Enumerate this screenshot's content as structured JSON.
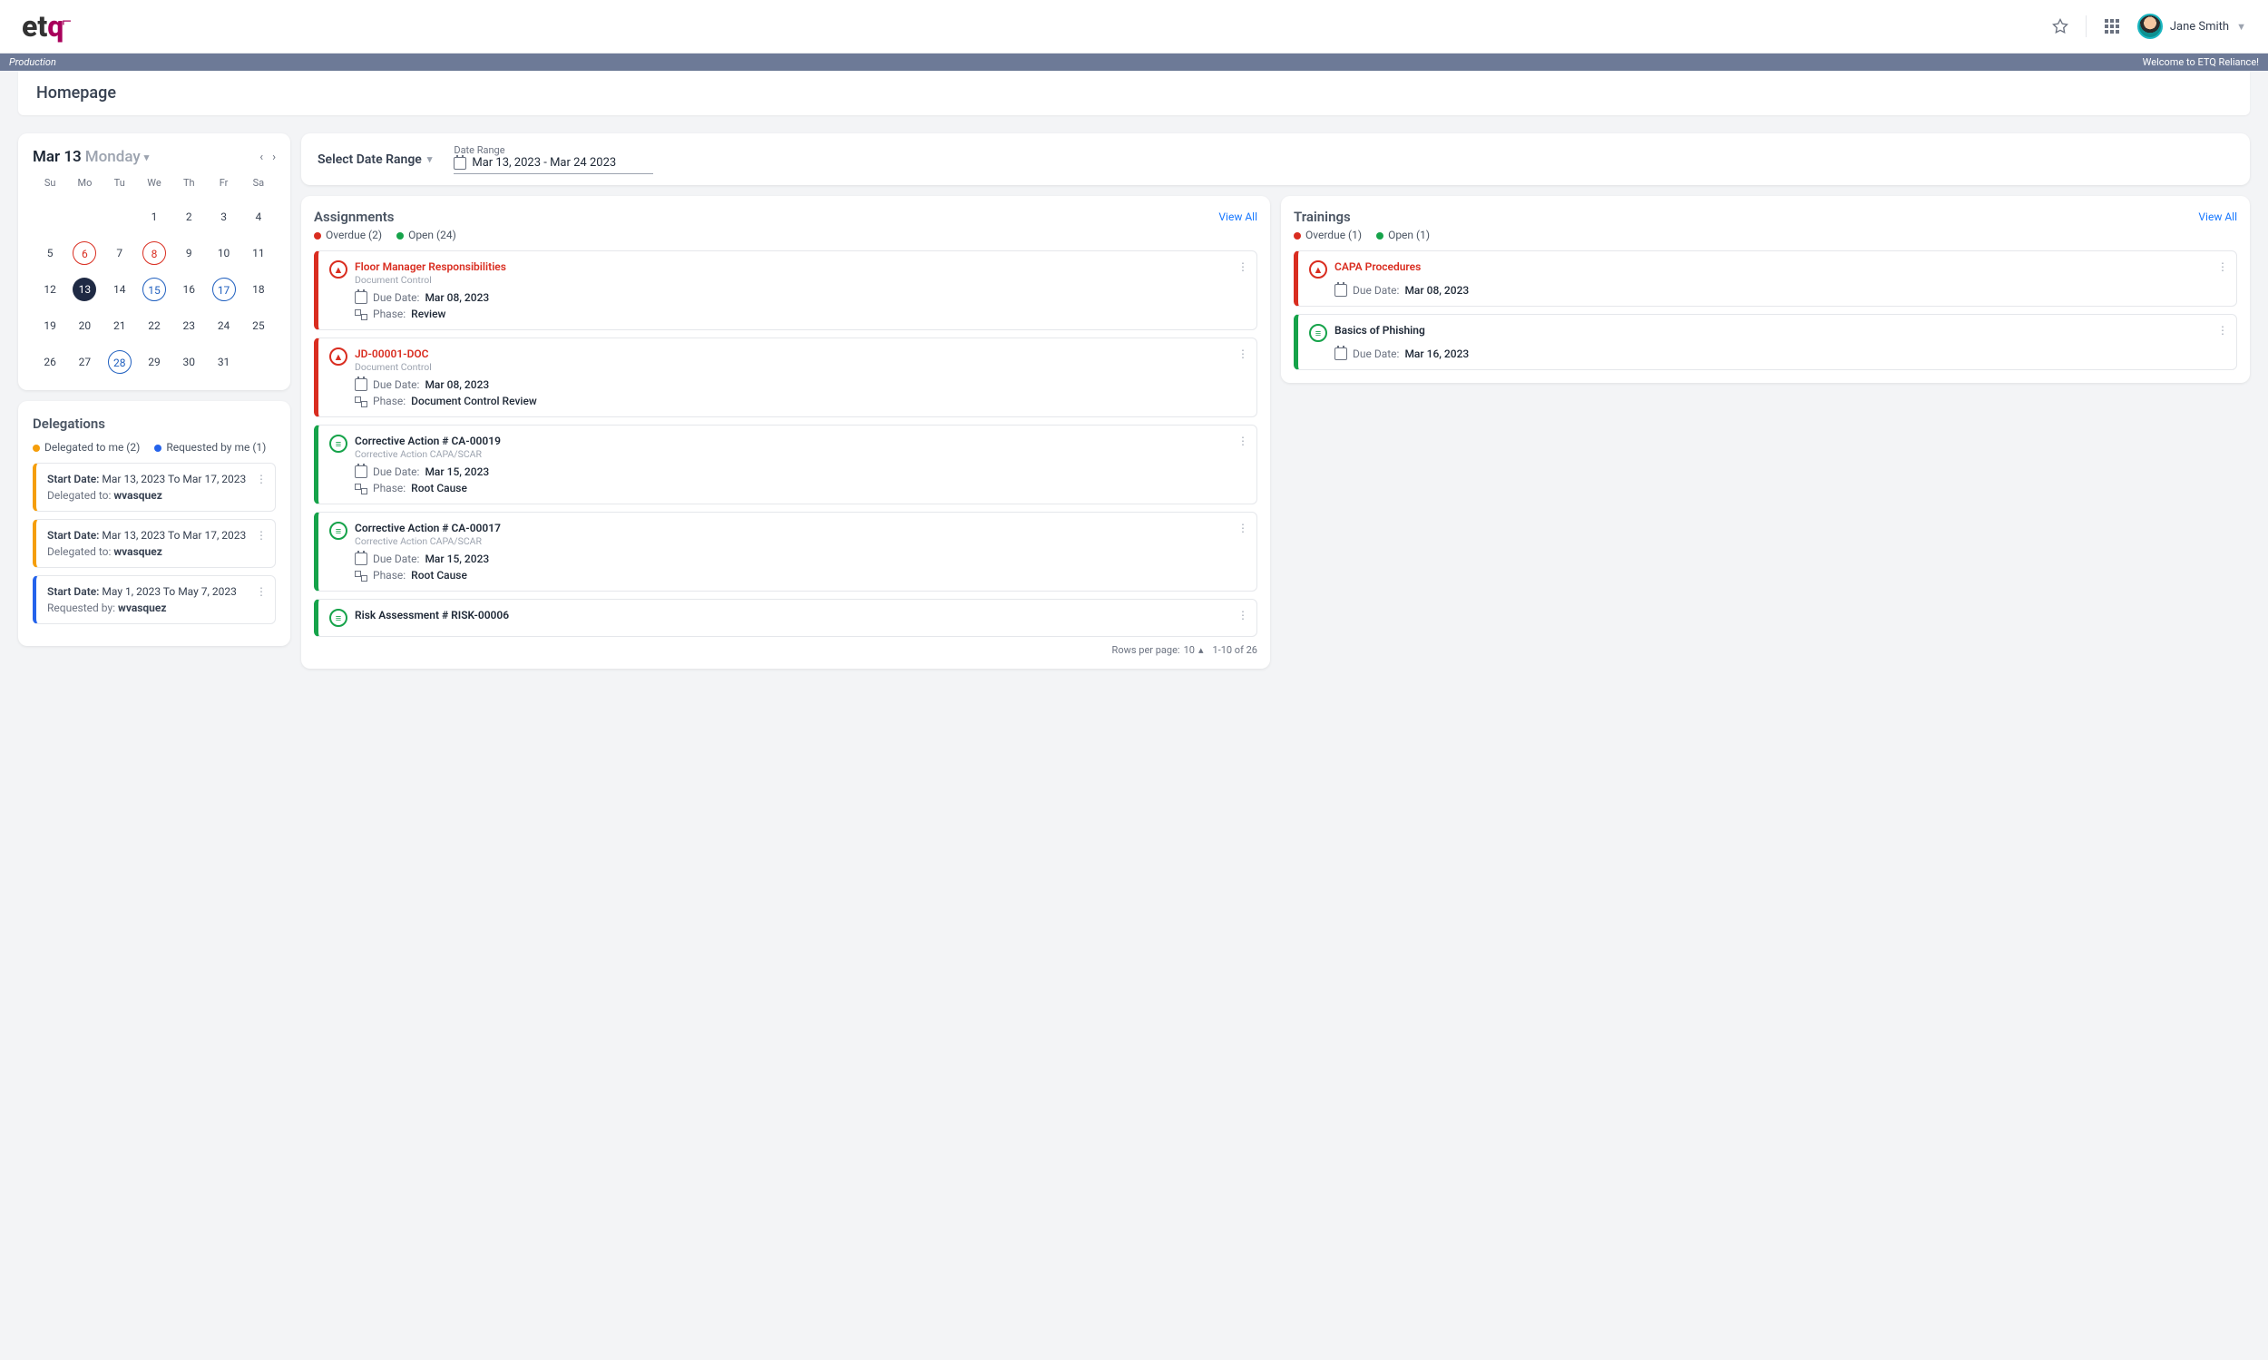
{
  "header": {
    "user_name": "Jane Smith"
  },
  "envbar": {
    "left": "Production",
    "right": "Welcome to ETQ Reliance!"
  },
  "page_title": "Homepage",
  "calendar": {
    "date_label": "Mar 13",
    "day_label": "Monday",
    "dow": [
      "Su",
      "Mo",
      "Tu",
      "We",
      "Th",
      "Fr",
      "Sa"
    ],
    "weeks": [
      [
        "",
        "",
        "",
        "1",
        "2",
        "3",
        "4"
      ],
      [
        "5",
        "6",
        "7",
        "8",
        "9",
        "10",
        "11"
      ],
      [
        "12",
        "13",
        "14",
        "15",
        "16",
        "17",
        "18"
      ],
      [
        "19",
        "20",
        "21",
        "22",
        "23",
        "24",
        "25"
      ],
      [
        "26",
        "27",
        "28",
        "29",
        "30",
        "31",
        ""
      ]
    ],
    "redring": [
      "6",
      "8"
    ],
    "bluering": [
      "15",
      "17",
      "28"
    ],
    "selected": "13"
  },
  "delegations": {
    "title": "Delegations",
    "legend": {
      "to_me_label": "Delegated to me (2)",
      "by_me_label": "Requested by me (1)"
    },
    "items": [
      {
        "edge": "#f59e0b",
        "start_label": "Start Date:",
        "start": "Mar 13, 2023",
        "to_label": "To",
        "end": "Mar 17, 2023",
        "sub_label": "Delegated to:",
        "sub": "wvasquez"
      },
      {
        "edge": "#f59e0b",
        "start_label": "Start Date:",
        "start": "Mar 13, 2023",
        "to_label": "To",
        "end": "Mar 17, 2023",
        "sub_label": "Delegated to:",
        "sub": "wvasquez"
      },
      {
        "edge": "#2563eb",
        "start_label": "Start Date:",
        "start": "May 1, 2023",
        "to_label": "To",
        "end": "May 7, 2023",
        "sub_label": "Requested by:",
        "sub": "wvasquez"
      }
    ]
  },
  "daterange": {
    "select_label": "Select Date Range",
    "field_label": "Date Range",
    "value": "Mar 13, 2023 - Mar 24 2023"
  },
  "assignments": {
    "title": "Assignments",
    "view_all": "View All",
    "legend": {
      "overdue": "Overdue (2)",
      "open": "Open (24)"
    },
    "items": [
      {
        "edge": "#d92d20",
        "icon": "warn",
        "title": "Floor Manager Responsibilities",
        "title_red": true,
        "subtype": "Document Control",
        "due_label": "Due Date:",
        "due": "Mar 08, 2023",
        "phase_label": "Phase:",
        "phase": "Review"
      },
      {
        "edge": "#d92d20",
        "icon": "warn",
        "title": "JD-00001-DOC",
        "title_red": true,
        "subtype": "Document Control",
        "due_label": "Due Date:",
        "due": "Mar 08, 2023",
        "phase_label": "Phase:",
        "phase": "Document Control Review"
      },
      {
        "edge": "#16a34a",
        "icon": "doc",
        "title": "Corrective Action # CA-00019",
        "subtype": "Corrective Action CAPA/SCAR",
        "due_label": "Due Date:",
        "due": "Mar 15, 2023",
        "phase_label": "Phase:",
        "phase": "Root Cause"
      },
      {
        "edge": "#16a34a",
        "icon": "doc",
        "title": "Corrective Action # CA-00017",
        "subtype": "Corrective Action CAPA/SCAR",
        "due_label": "Due Date:",
        "due": "Mar 15, 2023",
        "phase_label": "Phase:",
        "phase": "Root Cause"
      },
      {
        "edge": "#16a34a",
        "icon": "doc",
        "title": "Risk Assessment # RISK-00006"
      }
    ],
    "pager": {
      "rows_label": "Rows per page:",
      "rows": "10",
      "range": "1-10 of 26"
    }
  },
  "trainings": {
    "title": "Trainings",
    "view_all": "View All",
    "legend": {
      "overdue": "Overdue (1)",
      "open": "Open (1)"
    },
    "items": [
      {
        "edge": "#d92d20",
        "icon": "warn",
        "title": "CAPA Procedures",
        "title_red": true,
        "due_label": "Due Date:",
        "due": "Mar 08, 2023"
      },
      {
        "edge": "#16a34a",
        "icon": "doc",
        "title": "Basics of Phishing",
        "due_label": "Due Date:",
        "due": "Mar 16, 2023"
      }
    ]
  }
}
